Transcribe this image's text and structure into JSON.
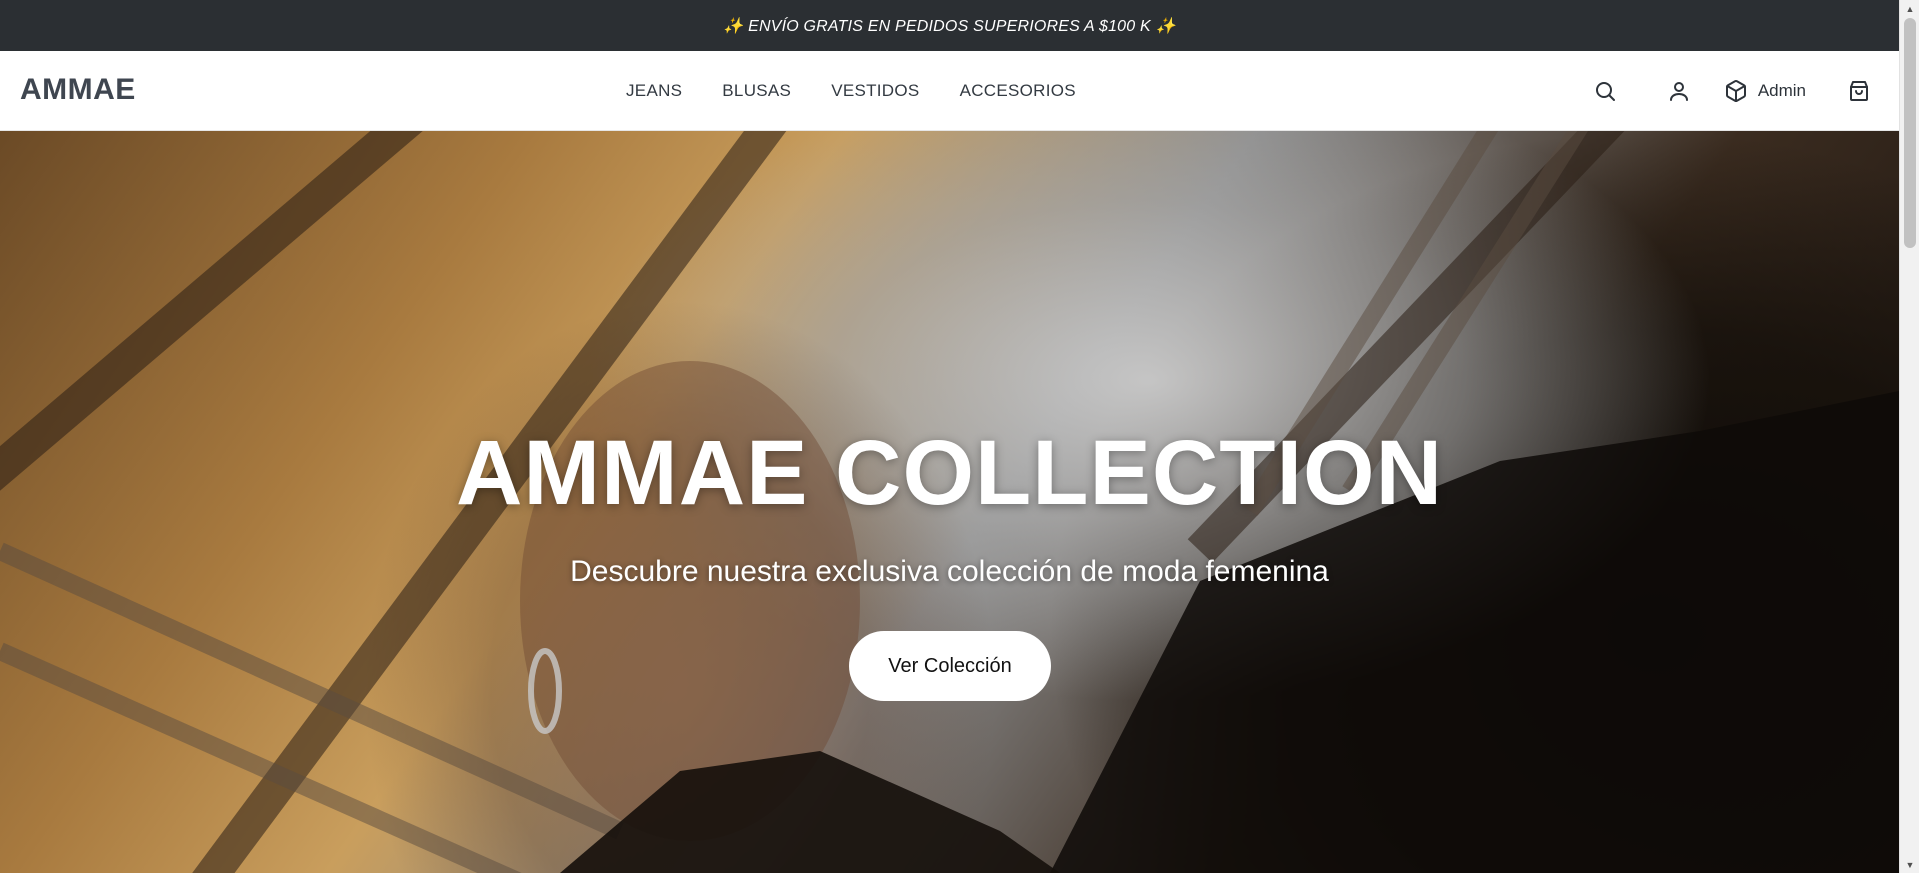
{
  "announcement": {
    "text": "✨ ENVÍO GRATIS EN PEDIDOS SUPERIORES A $100 K ✨"
  },
  "header": {
    "logo": "AMMAE",
    "nav": [
      {
        "label": "JEANS"
      },
      {
        "label": "BLUSAS"
      },
      {
        "label": "VESTIDOS"
      },
      {
        "label": "ACCESORIOS"
      }
    ],
    "actions": {
      "search_icon": "search-icon",
      "account_icon": "user-icon",
      "admin_icon": "box-icon",
      "admin_label": "Admin",
      "cart_icon": "shopping-bag-icon"
    }
  },
  "hero": {
    "title": "AMMAE COLLECTION",
    "subtitle": "Descubre nuestra exclusiva colección de moda femenina",
    "cta_label": "Ver Colección"
  },
  "colors": {
    "announcement_bg": "#2b2f33",
    "logo": "#3f4650",
    "text": "#333a42",
    "cta_bg": "#ffffff"
  }
}
